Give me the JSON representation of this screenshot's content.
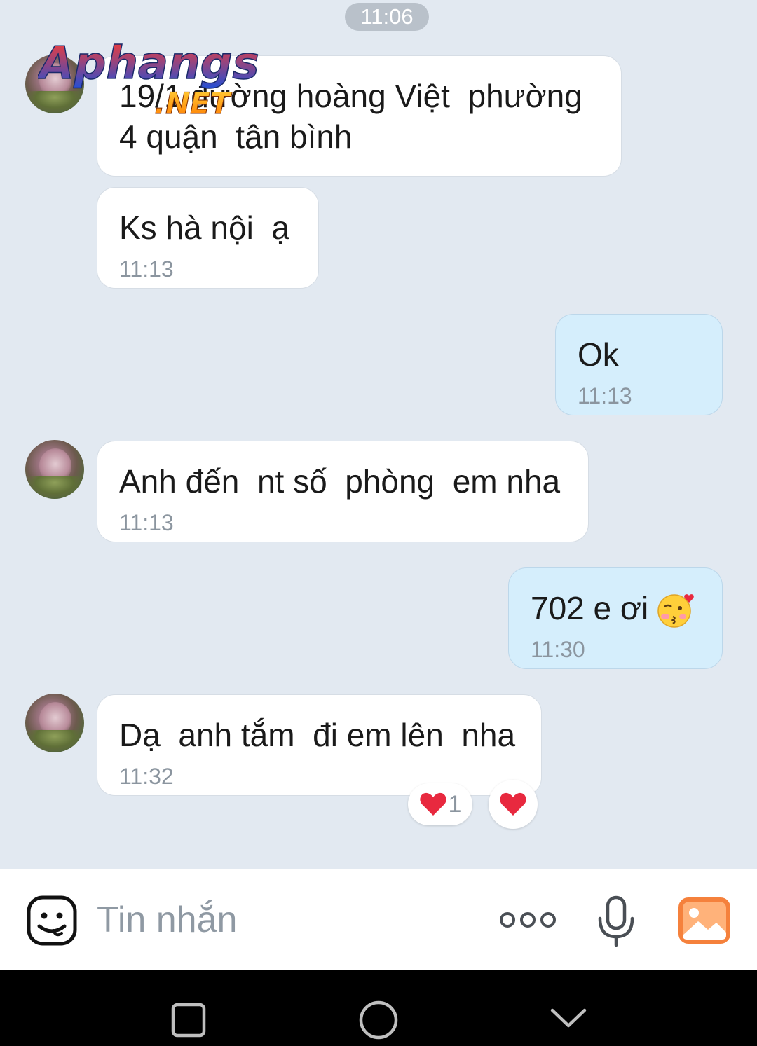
{
  "header": {
    "timestamp": "11:06"
  },
  "watermark": {
    "brand": "Aphangs",
    "suffix": ".NET"
  },
  "messages": [
    {
      "side": "in",
      "text": "19/1 đường hoàng Việt  phường\n4 quận  tân bình",
      "time": ""
    },
    {
      "side": "in",
      "text": "Ks hà nội  ạ",
      "time": "11:13"
    },
    {
      "side": "out",
      "text": "Ok",
      "time": "11:13"
    },
    {
      "side": "in",
      "text": "Anh đến  nt số  phòng  em nha",
      "time": "11:13"
    },
    {
      "side": "out",
      "text": "702 e ơi",
      "time": "11:30",
      "emoji": "kissing-face-with-heart-icon"
    },
    {
      "side": "in",
      "text": "Dạ  anh tắm  đi em lên  nha",
      "time": "11:32"
    }
  ],
  "reactions": {
    "heart_count": "1"
  },
  "composer": {
    "placeholder": "Tin nhắn",
    "icons": [
      "sticker-icon",
      "more-icon",
      "microphone-icon",
      "gallery-icon"
    ],
    "accent_color": "#f5813c"
  },
  "navigation": {
    "icons": [
      "recents-icon",
      "home-icon",
      "back-icon"
    ]
  },
  "colors": {
    "background": "#e2e9f1",
    "incoming_bubble": "#ffffff",
    "outgoing_bubble": "#d5eefc",
    "heart": "#e8293f"
  }
}
